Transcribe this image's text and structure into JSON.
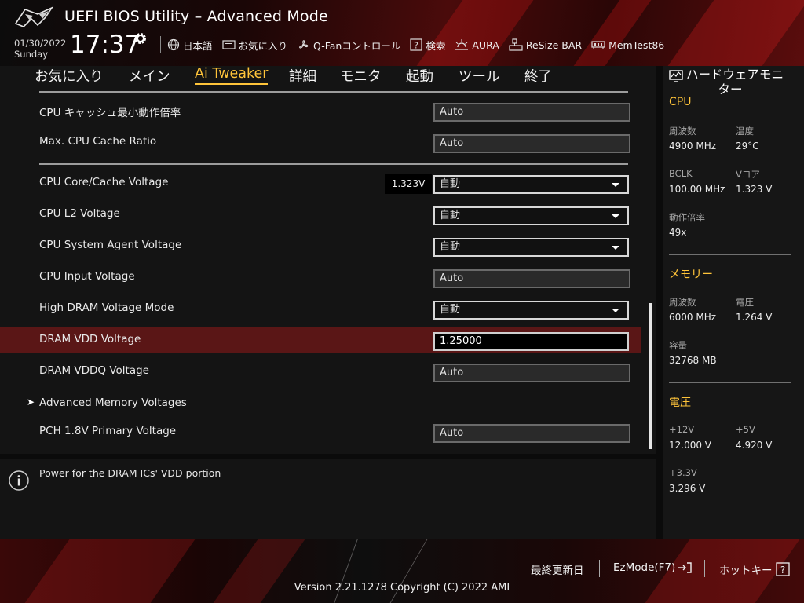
{
  "header": {
    "title": "UEFI BIOS Utility – Advanced Mode",
    "date": "01/30/2022",
    "day": "Sunday",
    "time": "17:37",
    "toolbar": [
      {
        "label": "日本語",
        "icon": "globe-icon"
      },
      {
        "label": "お気に入り",
        "icon": "favorites-icon"
      },
      {
        "label": "Q-Fanコントロール",
        "icon": "fan-icon"
      },
      {
        "label": "検索",
        "icon": "search-help-icon"
      },
      {
        "label": "AURA",
        "icon": "aura-icon"
      },
      {
        "label": "ReSize BAR",
        "icon": "resize-bar-icon"
      },
      {
        "label": "MemTest86",
        "icon": "memtest-icon"
      }
    ]
  },
  "menu": {
    "items": [
      "お気に入り",
      "メイン",
      "Ai Tweaker",
      "詳細",
      "モニタ",
      "起動",
      "ツール",
      "終了"
    ],
    "active": "Ai Tweaker"
  },
  "settings": {
    "rows": [
      {
        "label": "CPU キャッシュ最小動作倍率",
        "value": "Auto",
        "kind": "field"
      },
      {
        "label": "Max. CPU Cache Ratio",
        "value": "Auto",
        "kind": "field"
      },
      {
        "label": "CPU Core/Cache Voltage",
        "value": "自動",
        "kind": "dropdown",
        "current": "1.323V"
      },
      {
        "label": "CPU L2 Voltage",
        "value": "自動",
        "kind": "dropdown"
      },
      {
        "label": "CPU System Agent Voltage",
        "value": "自動",
        "kind": "dropdown"
      },
      {
        "label": "CPU Input Voltage",
        "value": "Auto",
        "kind": "field"
      },
      {
        "label": "High DRAM Voltage Mode",
        "value": "自動",
        "kind": "dropdown"
      },
      {
        "label": "DRAM VDD Voltage",
        "value": "1.25000",
        "kind": "input",
        "selected": true
      },
      {
        "label": "DRAM VDDQ Voltage",
        "value": "Auto",
        "kind": "field"
      },
      {
        "label": "Advanced Memory Voltages",
        "kind": "submenu"
      },
      {
        "label": "PCH 1.8V Primary Voltage",
        "value": "Auto",
        "kind": "field"
      }
    ]
  },
  "help": {
    "text": "Power for the DRAM ICs' VDD portion"
  },
  "monitor": {
    "title_line1": "ハードウェアモニ",
    "title_line2": "ター",
    "cpu": {
      "heading": "CPU",
      "freq_label": "周波数",
      "freq": "4900 MHz",
      "temp_label": "温度",
      "temp": "29°C",
      "bclk_label": "BCLK",
      "bclk": "100.00 MHz",
      "vcore_label": "Vコア",
      "vcore": "1.323 V",
      "ratio_label": "動作倍率",
      "ratio": "49x"
    },
    "memory": {
      "heading": "メモリー",
      "freq_label": "周波数",
      "freq": "6000 MHz",
      "volt_label": "電圧",
      "volt": "1.264 V",
      "cap_label": "容量",
      "cap": "32768 MB"
    },
    "voltage": {
      "heading": "電圧",
      "v12_label": "+12V",
      "v12": "12.000 V",
      "v5_label": "+5V",
      "v5": "4.920 V",
      "v33_label": "+3.3V",
      "v33": "3.296 V"
    }
  },
  "footer": {
    "last_modified": "最終更新日",
    "ezmode": "EzMode(F7)",
    "hotkeys": "ホットキー",
    "version": "Version 2.21.1278 Copyright (C) 2022 AMI"
  },
  "colors": {
    "accent": "#ffc43a",
    "selected_row": "#5a1616",
    "brand_red": "#b01818"
  }
}
